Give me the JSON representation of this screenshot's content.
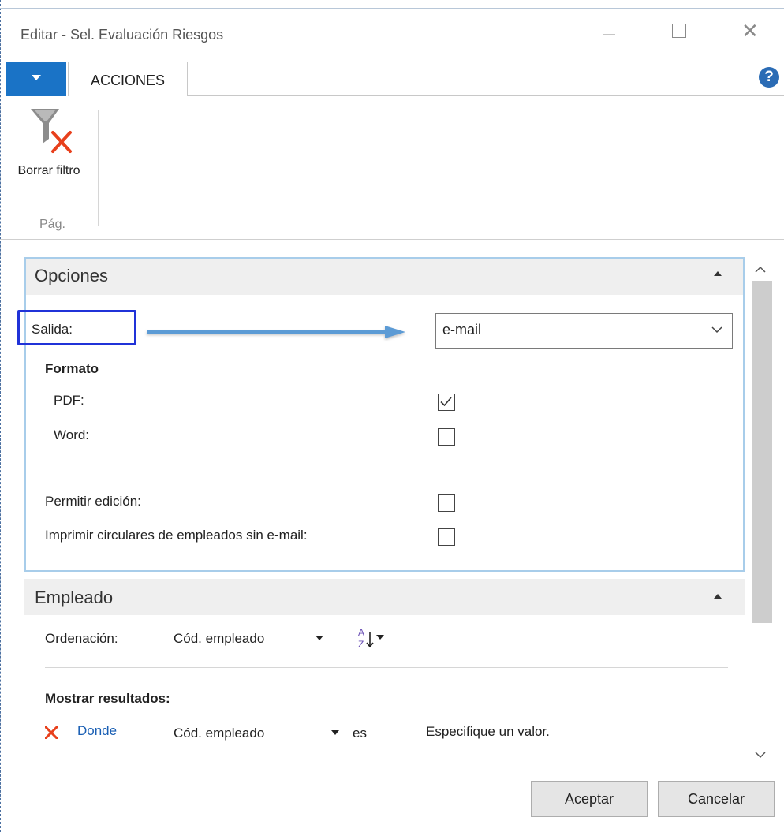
{
  "window": {
    "title": "Editar - Sel. Evaluación Riesgos"
  },
  "ribbon": {
    "tab_label": "ACCIONES",
    "clear_filter_label": "Borrar filtro",
    "group_label": "Pág."
  },
  "opciones": {
    "title": "Opciones",
    "salida_label": "Salida:",
    "salida_value": "e-mail",
    "formato_label": "Formato",
    "pdf_label": "PDF:",
    "pdf_checked": true,
    "word_label": "Word:",
    "word_checked": false,
    "permitir_edicion_label": "Permitir edición:",
    "permitir_edicion_checked": false,
    "imprimir_circulares_label": "Imprimir circulares de empleados sin e-mail:",
    "imprimir_circulares_checked": false
  },
  "empleado": {
    "title": "Empleado",
    "ordenacion_label": "Ordenación:",
    "sort_field": "Cód. empleado",
    "mostrar_label": "Mostrar resultados:",
    "donde_label": "Donde",
    "filter_field": "Cód. empleado",
    "filter_operator": "es",
    "filter_value": "Especifique un valor."
  },
  "buttons": {
    "ok": "Aceptar",
    "cancel": "Cancelar"
  },
  "colors": {
    "accent": "#1a73c6",
    "highlight_box": "#2032d8",
    "annotation_arrow": "#5b9bd5",
    "panel_border": "#a8cdea",
    "remove_icon": "#e8401c",
    "link": "#1a5fb4"
  }
}
